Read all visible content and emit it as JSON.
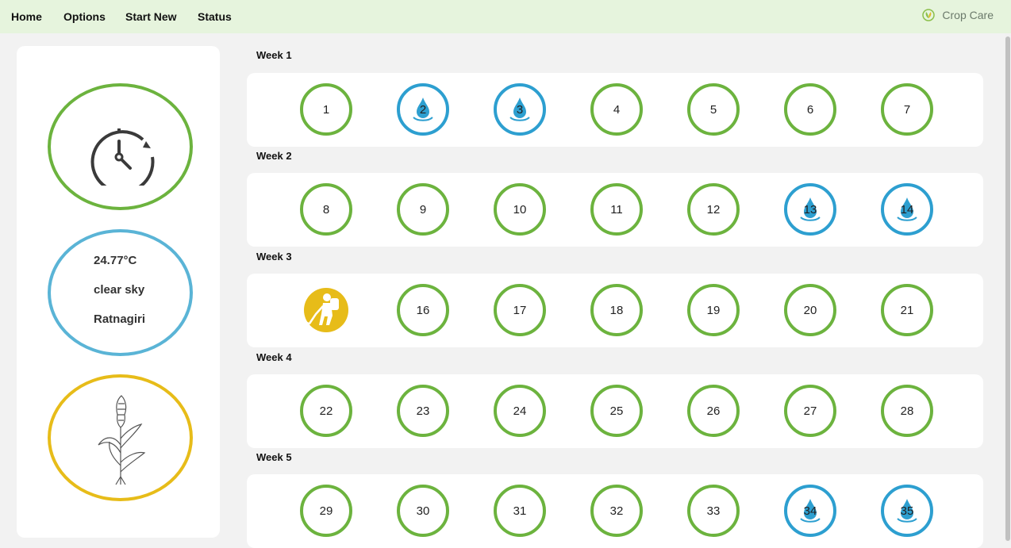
{
  "nav": {
    "items": [
      {
        "label": "Home"
      },
      {
        "label": "Options"
      },
      {
        "label": "Start New"
      },
      {
        "label": "Status"
      }
    ],
    "brand": "Crop Care"
  },
  "weather": {
    "temperature": "24.77°C",
    "condition": "clear sky",
    "location": "Ratnagiri"
  },
  "colors": {
    "normal": "#6cb33e",
    "water": "#2d9fd0",
    "spray": "#e7bc19"
  },
  "weeks": [
    {
      "label": "Week 1",
      "days": [
        {
          "num": "1",
          "type": "normal"
        },
        {
          "num": "2",
          "type": "water"
        },
        {
          "num": "3",
          "type": "water"
        },
        {
          "num": "4",
          "type": "normal"
        },
        {
          "num": "5",
          "type": "normal"
        },
        {
          "num": "6",
          "type": "normal"
        },
        {
          "num": "7",
          "type": "normal"
        }
      ]
    },
    {
      "label": "Week 2",
      "days": [
        {
          "num": "8",
          "type": "normal"
        },
        {
          "num": "9",
          "type": "normal"
        },
        {
          "num": "10",
          "type": "normal"
        },
        {
          "num": "11",
          "type": "normal"
        },
        {
          "num": "12",
          "type": "normal"
        },
        {
          "num": "13",
          "type": "water"
        },
        {
          "num": "14",
          "type": "water"
        }
      ]
    },
    {
      "label": "Week 3",
      "days": [
        {
          "num": "",
          "type": "spray"
        },
        {
          "num": "16",
          "type": "normal"
        },
        {
          "num": "17",
          "type": "normal"
        },
        {
          "num": "18",
          "type": "normal"
        },
        {
          "num": "19",
          "type": "normal"
        },
        {
          "num": "20",
          "type": "normal"
        },
        {
          "num": "21",
          "type": "normal"
        }
      ]
    },
    {
      "label": "Week 4",
      "days": [
        {
          "num": "22",
          "type": "normal"
        },
        {
          "num": "23",
          "type": "normal"
        },
        {
          "num": "24",
          "type": "normal"
        },
        {
          "num": "25",
          "type": "normal"
        },
        {
          "num": "26",
          "type": "normal"
        },
        {
          "num": "27",
          "type": "normal"
        },
        {
          "num": "28",
          "type": "normal"
        }
      ]
    },
    {
      "label": "Week 5",
      "days": [
        {
          "num": "29",
          "type": "normal"
        },
        {
          "num": "30",
          "type": "normal"
        },
        {
          "num": "31",
          "type": "normal"
        },
        {
          "num": "32",
          "type": "normal"
        },
        {
          "num": "33",
          "type": "normal"
        },
        {
          "num": "34",
          "type": "water"
        },
        {
          "num": "35",
          "type": "water"
        }
      ]
    }
  ]
}
